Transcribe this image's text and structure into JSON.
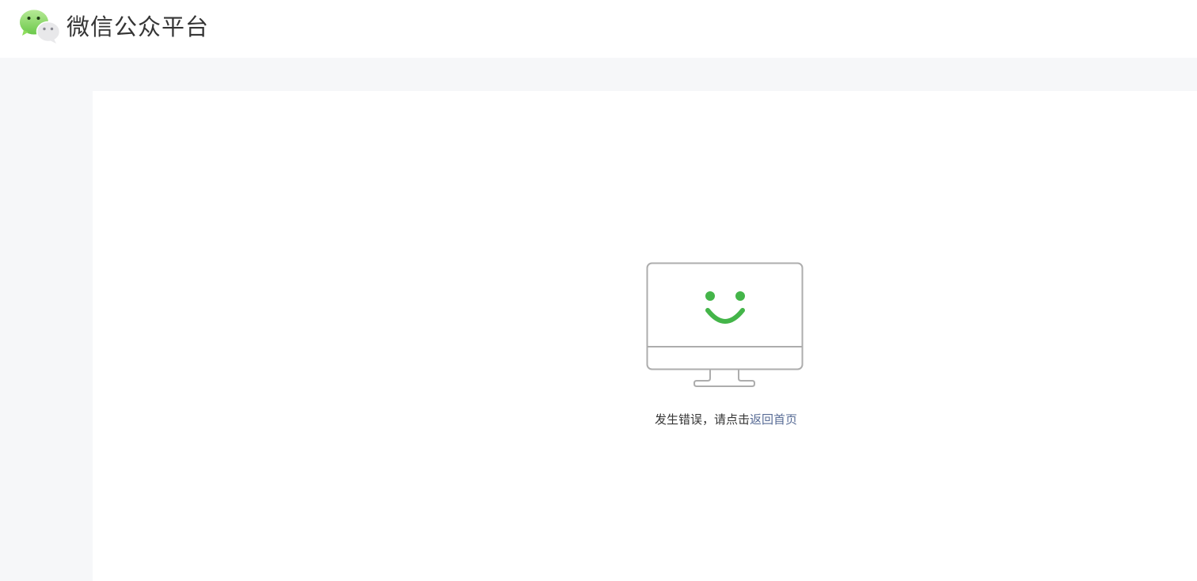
{
  "header": {
    "logo_icon": "wechat-logo-icon",
    "title": "微信公众平台"
  },
  "error": {
    "illustration_icon": "smiling-monitor-icon",
    "message": "发生错误，请点击",
    "link_label": "返回首页"
  },
  "colors": {
    "accent_green": "#44b549",
    "link_blue": "#576b95",
    "page_bg": "#f6f7f9",
    "icon_gray": "#adadad"
  }
}
